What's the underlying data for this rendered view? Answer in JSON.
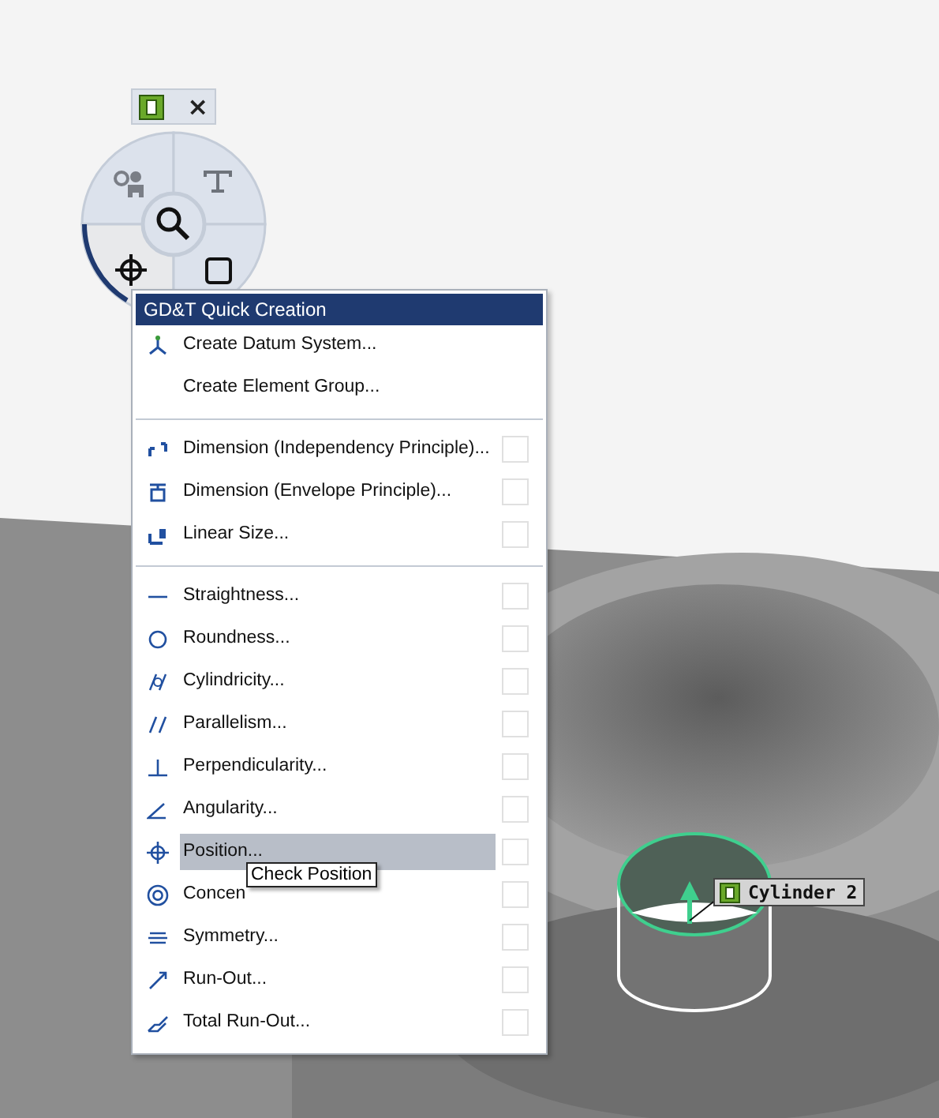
{
  "toolbar": {
    "buttons": [
      {
        "kind": "feature"
      },
      {
        "kind": "close",
        "label": "×"
      }
    ]
  },
  "pie_menu": {
    "segments": [
      {
        "selected": false
      },
      {
        "selected": false
      },
      {
        "selected": true
      },
      {
        "selected": false
      }
    ]
  },
  "menu": {
    "title": "GD&T Quick Creation",
    "groups": [
      [
        {
          "kind": "command",
          "label": "Create Datum System...",
          "selected": false
        },
        {
          "kind": "command",
          "label": "Create Element Group...",
          "selected": false
        }
      ],
      [
        {
          "kind": "check",
          "label": "Dimension (Independency Principle)...",
          "selected": false,
          "checked": false
        },
        {
          "kind": "check",
          "label": "Dimension (Envelope Principle)...",
          "selected": false,
          "checked": false
        },
        {
          "kind": "check",
          "label": "Linear Size...",
          "selected": false,
          "checked": false
        }
      ],
      [
        {
          "kind": "check",
          "label": "Straightness...",
          "selected": false,
          "checked": false
        },
        {
          "kind": "check",
          "label": "Roundness...",
          "selected": false,
          "checked": false
        },
        {
          "kind": "check",
          "label": "Cylindricity...",
          "selected": false,
          "checked": false
        },
        {
          "kind": "check",
          "label": "Parallelism...",
          "selected": false,
          "checked": false
        },
        {
          "kind": "check",
          "label": "Perpendicularity...",
          "selected": false,
          "checked": false
        },
        {
          "kind": "check",
          "label": "Angularity...",
          "selected": false,
          "checked": false
        },
        {
          "kind": "check",
          "label": "Position...",
          "selected": true,
          "checked": false
        },
        {
          "kind": "check",
          "label": "Concen",
          "selected": false,
          "checked": false
        },
        {
          "kind": "check",
          "label": "Symmetry...",
          "selected": false,
          "checked": false
        },
        {
          "kind": "check",
          "label": "Run-Out...",
          "selected": false,
          "checked": false
        },
        {
          "kind": "check",
          "label": "Total Run-Out...",
          "selected": false,
          "checked": false
        }
      ]
    ]
  },
  "tooltip": {
    "text": "Check Position"
  },
  "feature_label": {
    "text": "Cylinder 2"
  }
}
